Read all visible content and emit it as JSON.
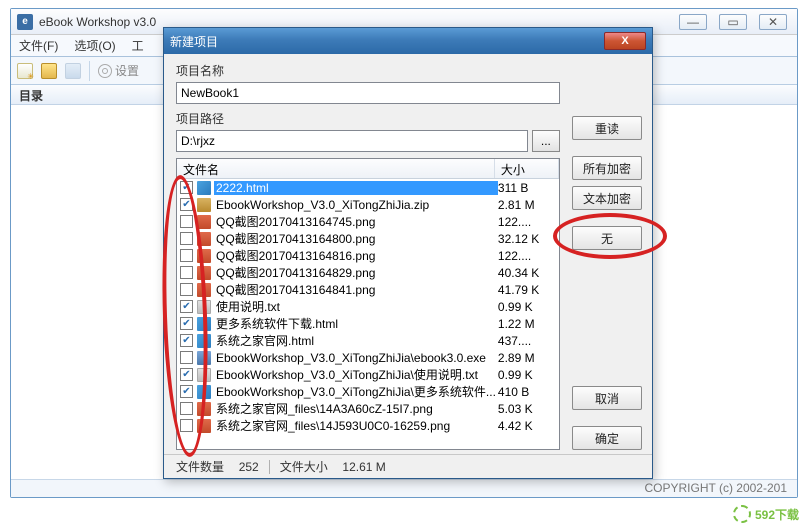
{
  "main": {
    "title": "eBook Workshop v3.0",
    "menu": {
      "file": "文件(F)",
      "options": "选项(O)",
      "tools": "工"
    },
    "toolbar": {
      "settings": "设置"
    },
    "dir_header": "目录",
    "copyright": "COPYRIGHT (c) 2002-201"
  },
  "dialog": {
    "title": "新建项目",
    "name_label": "项目名称",
    "name_value": "NewBook1",
    "path_label": "项目路径",
    "path_value": "D:\\rjxz",
    "browse": "...",
    "col_name": "文件名",
    "col_size": "大小",
    "buttons": {
      "reread": "重读",
      "all_encrypt": "所有加密",
      "text_encrypt": "文本加密",
      "none": "无",
      "cancel": "取消",
      "ok": "确定"
    },
    "status": {
      "count_label": "文件数量",
      "count": "252",
      "size_label": "文件大小",
      "size": "12.61 M"
    },
    "files": [
      {
        "chk": true,
        "icon": "html",
        "name": "2222.html",
        "size": "311 B",
        "sel": true
      },
      {
        "chk": true,
        "icon": "zip",
        "name": "EbookWorkshop_V3.0_XiTongZhiJia.zip",
        "size": "2.81 M"
      },
      {
        "chk": false,
        "icon": "png",
        "name": "QQ截图20170413164745.png",
        "size": "122...."
      },
      {
        "chk": false,
        "icon": "png",
        "name": "QQ截图20170413164800.png",
        "size": "32.12 K"
      },
      {
        "chk": false,
        "icon": "png",
        "name": "QQ截图20170413164816.png",
        "size": "122...."
      },
      {
        "chk": false,
        "icon": "png",
        "name": "QQ截图20170413164829.png",
        "size": "40.34 K"
      },
      {
        "chk": false,
        "icon": "png",
        "name": "QQ截图20170413164841.png",
        "size": "41.79 K"
      },
      {
        "chk": true,
        "icon": "txt",
        "name": "使用说明.txt",
        "size": "0.99 K"
      },
      {
        "chk": true,
        "icon": "html",
        "name": "更多系统软件下载.html",
        "size": "1.22 M"
      },
      {
        "chk": true,
        "icon": "html",
        "name": "系统之家官网.html",
        "size": "437...."
      },
      {
        "chk": false,
        "icon": "exe",
        "name": "EbookWorkshop_V3.0_XiTongZhiJia\\ebook3.0.exe",
        "size": "2.89 M"
      },
      {
        "chk": true,
        "icon": "txt",
        "name": "EbookWorkshop_V3.0_XiTongZhiJia\\使用说明.txt",
        "size": "0.99 K"
      },
      {
        "chk": true,
        "icon": "html",
        "name": "EbookWorkshop_V3.0_XiTongZhiJia\\更多系统软件...",
        "size": "410 B"
      },
      {
        "chk": false,
        "icon": "png",
        "name": "系统之家官网_files\\14A3A60cZ-15I7.png",
        "size": "5.03 K"
      },
      {
        "chk": false,
        "icon": "png",
        "name": "系统之家官网_files\\14J593U0C0-16259.png",
        "size": "4.42 K"
      }
    ]
  },
  "watermark": "592下载"
}
